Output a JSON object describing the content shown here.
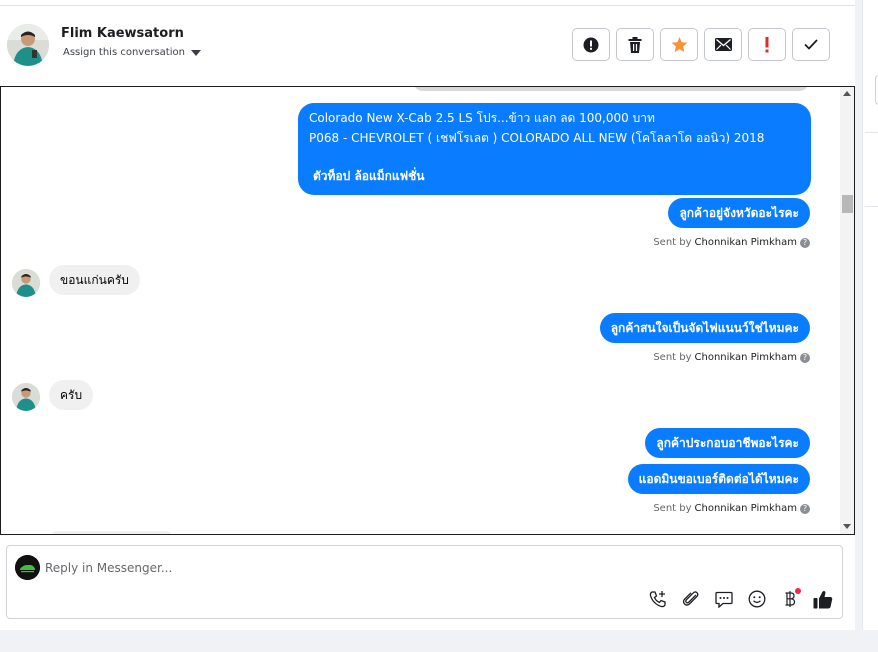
{
  "header": {
    "contact_name": "Flim Kaewsatorn",
    "assign_label": "Assign this conversation"
  },
  "actions": [
    {
      "name": "spam",
      "icon": "alert-circle-icon"
    },
    {
      "name": "delete",
      "icon": "trash-icon"
    },
    {
      "name": "star",
      "icon": "star-icon",
      "color": "#f7923a"
    },
    {
      "name": "mark-unread",
      "icon": "envelope-icon"
    },
    {
      "name": "important",
      "icon": "exclamation-icon",
      "color": "#e02a2a"
    },
    {
      "name": "done",
      "icon": "checkmark-icon"
    }
  ],
  "messages": {
    "product_line1": "Colorado New X-Cab 2.5 LS โปร...ข้าว แลก ลด 100,000 บาท",
    "product_line2": "P068 - CHEVROLET ( เชฟโรเลต ) COLORADO ALL NEW (โคโลลาโด ออนิว) 2018",
    "product_line3": "ตัวท็อป ล้อแม็กแฟชั่น",
    "out_1": "ลูกค้าอยู่จังหวัดอะไรคะ",
    "in_1": "ขอนแก่นครับ",
    "out_2": "ลูกค้าสนใจเป็นจัดไฟแนนว์ใช่ไหมคะ",
    "in_2": "ครับ",
    "out_3": "ลูกค้าประกอบอาชีพอะไรคะ",
    "out_4": "แอดมินขอเบอร์ติดต่อได้ไหมคะ"
  },
  "sent_by": {
    "prefix": "Sent by",
    "agent": "Chonnikan Pimkham"
  },
  "composer": {
    "placeholder": "Reply in Messenger..."
  },
  "colors": {
    "outgoing_bubble": "#0a7cff",
    "incoming_bubble": "#f0f0f0",
    "star": "#f7923a",
    "important": "#e02a2a"
  }
}
